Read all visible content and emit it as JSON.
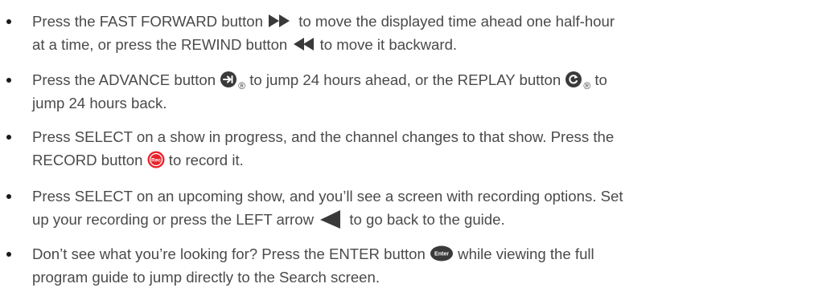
{
  "items": [
    {
      "l1a": "Press the FAST FORWARD button ",
      "l1b": " to move the displayed time ahead one half-hour",
      "l2a": "at a time, or press the REWIND button ",
      "l2b": " to move it backward.",
      "icons": [
        "fast-forward-icon",
        "rewind-icon"
      ]
    },
    {
      "l1a": "Press the ADVANCE button ",
      "l1b": " to jump 24 hours ahead, or the REPLAY button ",
      "l1c": " to",
      "l2a": "jump 24 hours back.",
      "reg": "®",
      "icons": [
        "advance-icon",
        "replay-icon"
      ]
    },
    {
      "l1a": "Press SELECT on a show in progress, and the channel changes to that show. Press the",
      "l2a": "RECORD button ",
      "l2b": " to record it.",
      "icon_label": "Rec",
      "icons": [
        "record-icon"
      ],
      "record_color": "#e8212a"
    },
    {
      "l1a": "Press SELECT on an upcoming show, and you’ll see a screen with recording options. Set",
      "l2a": "up your recording or press the LEFT arrow ",
      "l2b": " to go back to the guide.",
      "icons": [
        "left-arrow-icon"
      ]
    },
    {
      "l1a": "Don’t see what you’re looking for? Press the ENTER button ",
      "l1b": " while viewing the full",
      "l2a": "program guide to jump directly to the Search screen.",
      "icon_label": "Enter",
      "icons": [
        "enter-icon"
      ]
    }
  ],
  "colors": {
    "text": "#4a4a4a",
    "icon_dark": "#3a3a3a",
    "record": "#e8212a"
  }
}
